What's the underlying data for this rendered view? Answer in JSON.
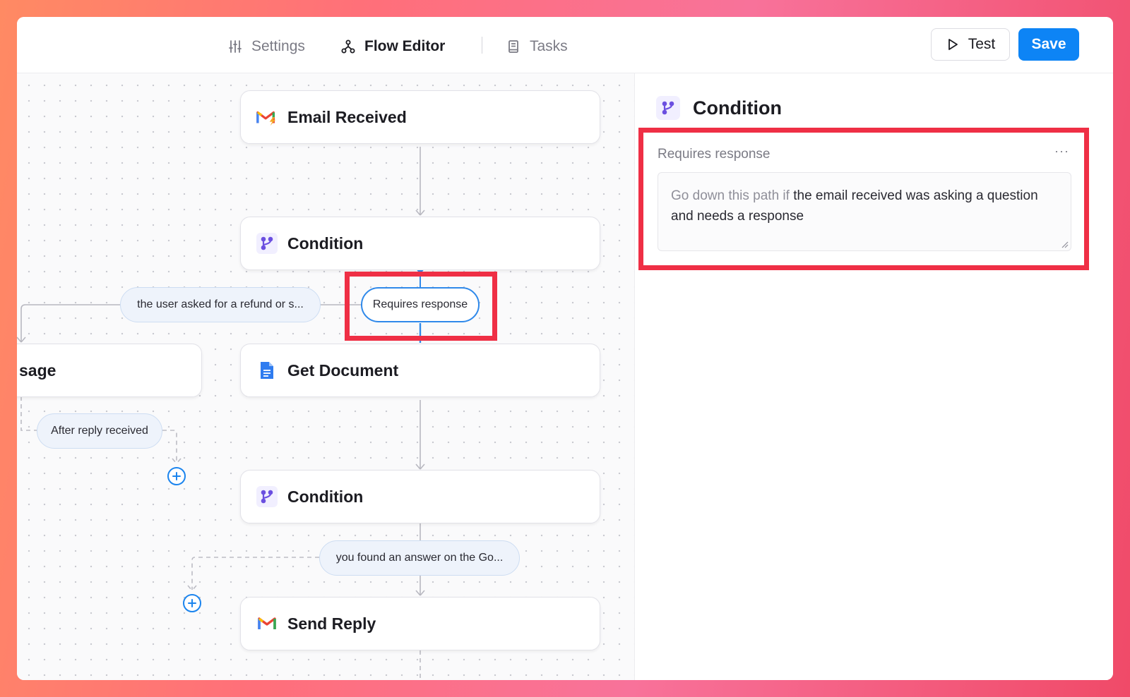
{
  "nav": {
    "tabs": [
      {
        "label": "Settings",
        "icon": "sliders-icon"
      },
      {
        "label": "Flow Editor",
        "icon": "flow-icon"
      },
      {
        "label": "Tasks",
        "icon": "book-icon"
      }
    ],
    "active_tab": "Flow Editor"
  },
  "toolbar": {
    "test_label": "Test",
    "save_label": "Save"
  },
  "canvas": {
    "nodes": [
      {
        "label": "Email Received",
        "icon": "gmail-trigger-icon"
      },
      {
        "label": "Condition",
        "icon": "branch-icon"
      },
      {
        "label": "sage",
        "icon": ""
      },
      {
        "label": "Get Document",
        "icon": "document-icon"
      },
      {
        "label": "Condition",
        "icon": "branch-icon"
      },
      {
        "label": "Send Reply",
        "icon": "gmail-icon"
      }
    ],
    "branches": [
      {
        "label": "the user asked for a refund or s..."
      },
      {
        "label": "Requires response",
        "selected": true
      },
      {
        "label": "After reply received"
      },
      {
        "label": "you found an answer on the Go..."
      }
    ]
  },
  "panel": {
    "title": "Condition",
    "condition_name": "Requires response",
    "more": "···",
    "prefix": "Go down this path if",
    "text": "the email received was asking a question and needs a response"
  },
  "colors": {
    "accent": "#0d84f5",
    "highlight": "#ef2f45",
    "branch_icon": "#6b4fe0"
  }
}
